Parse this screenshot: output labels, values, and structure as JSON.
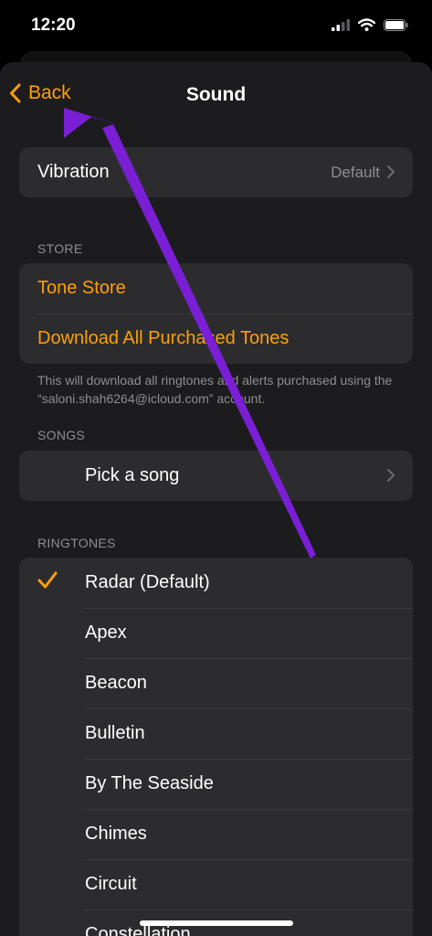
{
  "status_bar": {
    "time": "12:20",
    "icons": [
      "cellular-signal-icon",
      "wifi-icon",
      "battery-icon"
    ]
  },
  "nav": {
    "back_label": "Back",
    "title": "Sound"
  },
  "vibration": {
    "label": "Vibration",
    "value": "Default"
  },
  "store": {
    "header": "STORE",
    "items": [
      "Tone Store",
      "Download All Purchased Tones"
    ],
    "footer": "This will download all ringtones and alerts purchased using the “saloni.shah6264@icloud.com” account."
  },
  "songs": {
    "header": "SONGS",
    "pick_label": "Pick a song"
  },
  "ringtones": {
    "header": "RINGTONES",
    "items": [
      "Radar (Default)",
      "Apex",
      "Beacon",
      "Bulletin",
      "By The Seaside",
      "Chimes",
      "Circuit",
      "Constellation"
    ],
    "selected": "Radar (Default)"
  },
  "colors": {
    "accent": "#ff9f0a",
    "background": "#1c1c1e",
    "cell": "#2c2c2e",
    "secondary_text": "#8e8e93",
    "annotation_arrow": "#7a1fd6"
  }
}
